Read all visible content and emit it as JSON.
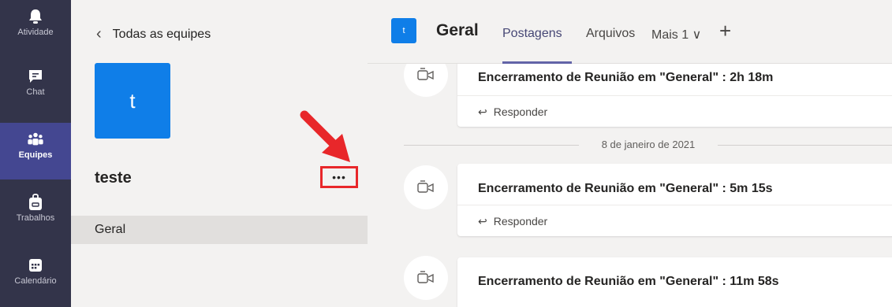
{
  "rail": {
    "items": [
      {
        "label": "Atividade",
        "icon": "bell-icon"
      },
      {
        "label": "Chat",
        "icon": "chat-icon"
      },
      {
        "label": "Equipes",
        "icon": "teams-icon",
        "active": true
      },
      {
        "label": "Trabalhos",
        "icon": "assignments-icon"
      },
      {
        "label": "Calendário",
        "icon": "calendar-icon"
      }
    ]
  },
  "panel": {
    "back_label": "Todas as equipes",
    "team_initial": "t",
    "team_name": "teste",
    "more_label": "•••",
    "channel": "Geral"
  },
  "header": {
    "avatar_initial": "t",
    "title": "Geral",
    "tabs": [
      {
        "label": "Postagens",
        "active": true
      },
      {
        "label": "Arquivos"
      },
      {
        "label": "Mais 1 ∨"
      }
    ],
    "add_label": "+"
  },
  "feed": {
    "posts": [
      {
        "title": "Encerramento de Reunião em \"General\" : 2h 18m",
        "reply": "Responder"
      },
      {
        "title": "Encerramento de Reunião em \"General\" : 5m 15s",
        "reply": "Responder"
      },
      {
        "title": "Encerramento de Reunião em \"General\" : 11m 58s"
      }
    ],
    "date_separator": "8 de janeiro de 2021"
  },
  "colors": {
    "rail_bg": "#33344a",
    "rail_active": "#444791",
    "accent": "#6264a7",
    "team_blue": "#0f7ee8",
    "highlight_red": "#e8272a"
  }
}
